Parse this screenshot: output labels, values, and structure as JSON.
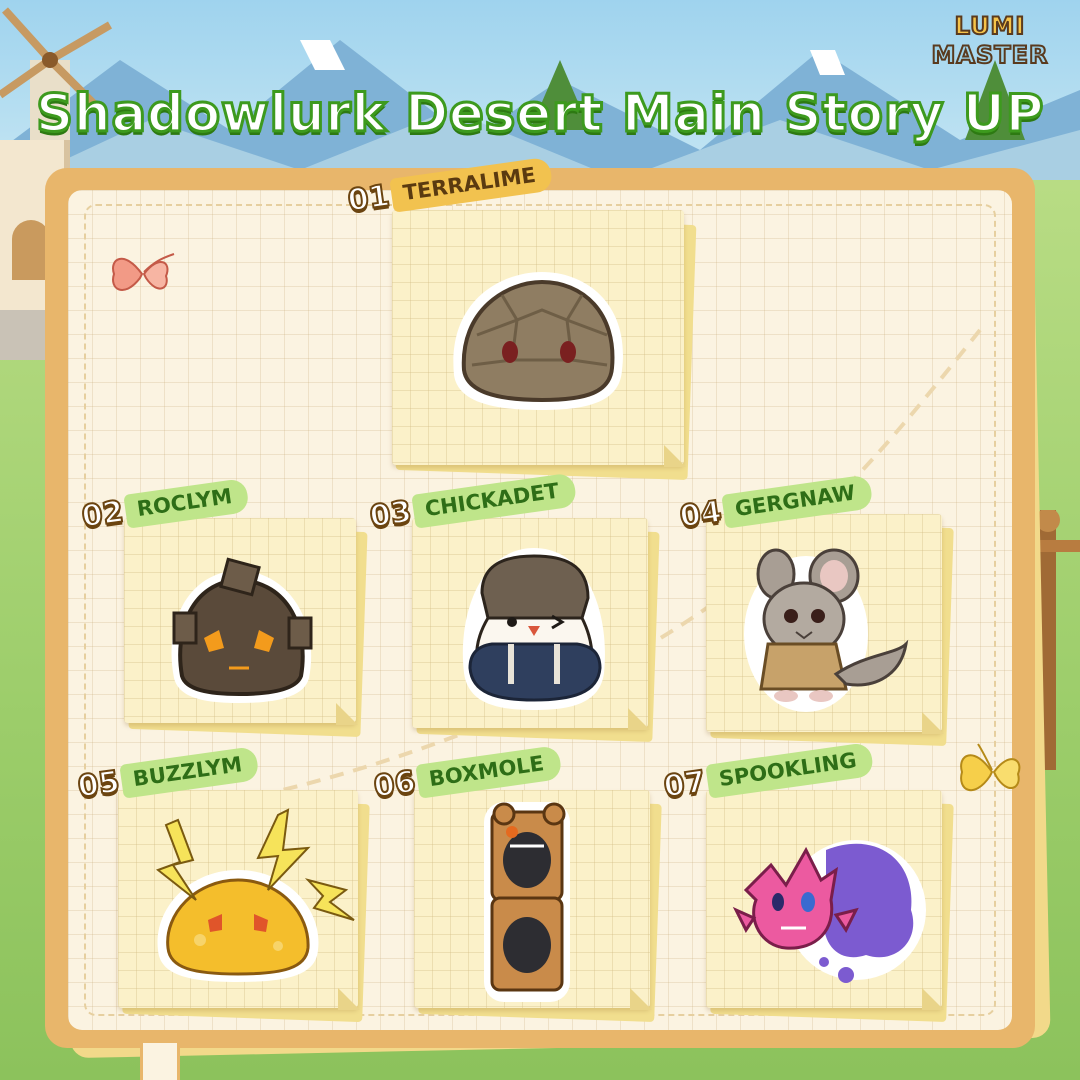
{
  "brand": {
    "logo_line1": "LUMI",
    "logo_line2": "MASTER"
  },
  "title": "Shadowlurk Desert Main Story UP",
  "cards": [
    {
      "number": "01",
      "name": "TERRALIME"
    },
    {
      "number": "02",
      "name": "ROCLYM"
    },
    {
      "number": "03",
      "name": "CHICKADET"
    },
    {
      "number": "04",
      "name": "GERGNAW"
    },
    {
      "number": "05",
      "name": "BUZZLYM"
    },
    {
      "number": "06",
      "name": "BOXMOLE"
    },
    {
      "number": "07",
      "name": "SPOOKLING"
    }
  ],
  "colors": {
    "title_fill": "#ffffff",
    "title_outline": "#3d9a1e",
    "label_gold": "#f2c24f",
    "label_green": "#bfe58a",
    "board": "#fbf3e1",
    "card": "#fbf1c9"
  },
  "icons": [
    "pink-butterfly-icon",
    "yellow-butterfly-icon"
  ]
}
